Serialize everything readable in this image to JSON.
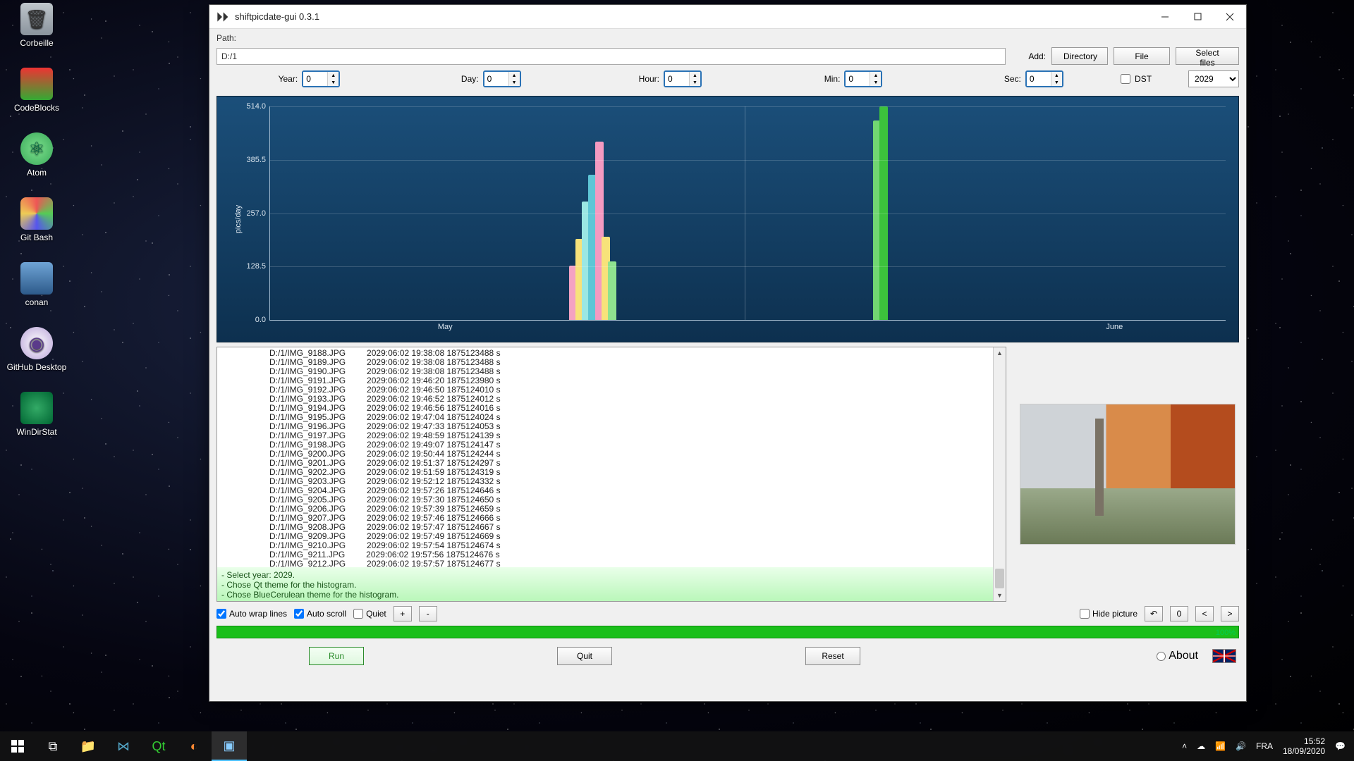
{
  "desktop": {
    "icons": [
      {
        "label": "Corbeille"
      },
      {
        "label": "CodeBlocks"
      },
      {
        "label": "Atom"
      },
      {
        "label": "Git Bash"
      },
      {
        "label": "conan"
      },
      {
        "label": "GitHub Desktop"
      },
      {
        "label": "WinDirStat"
      }
    ]
  },
  "window": {
    "title": "shiftpicdate-gui 0.3.1",
    "path_label": "Path:",
    "path_value": "D:/1",
    "add_label": "Add:",
    "btn_directory": "Directory",
    "btn_file": "File",
    "btn_select_files": "Select files",
    "dst_label": "DST",
    "year_select": "2029",
    "spinners": {
      "year": {
        "label": "Year:",
        "value": "0"
      },
      "day": {
        "label": "Day:",
        "value": "0"
      },
      "hour": {
        "label": "Hour:",
        "value": "0"
      },
      "min": {
        "label": "Min:",
        "value": "0"
      },
      "sec": {
        "label": "Sec:",
        "value": "0"
      }
    }
  },
  "chart_data": {
    "type": "bar",
    "ylabel": "pics/day",
    "ylim": [
      0,
      514
    ],
    "yticks": [
      0.0,
      128.5,
      257.0,
      385.5,
      514.0
    ],
    "xticks": [
      "May",
      "June"
    ],
    "series": [
      {
        "x_pct": 46.0,
        "value": 130,
        "color": "#f4a2c2"
      },
      {
        "x_pct": 47.0,
        "value": 195,
        "color": "#f7e27a"
      },
      {
        "x_pct": 48.0,
        "value": 285,
        "color": "#9be7e3"
      },
      {
        "x_pct": 49.0,
        "value": 350,
        "color": "#5ec6d6"
      },
      {
        "x_pct": 50.0,
        "value": 430,
        "color": "#f49ac1"
      },
      {
        "x_pct": 51.0,
        "value": 200,
        "color": "#f7e27a"
      },
      {
        "x_pct": 52.0,
        "value": 140,
        "color": "#8fe28f"
      },
      {
        "x_pct": 92.8,
        "value": 480,
        "color": "#72d672"
      },
      {
        "x_pct": 93.8,
        "value": 514,
        "color": "#3cc23c"
      }
    ]
  },
  "log": {
    "lines": [
      "D:/1/IMG_9188.JPG         2029:06:02 19:38:08 1875123488 s",
      "D:/1/IMG_9189.JPG         2029:06:02 19:38:08 1875123488 s",
      "D:/1/IMG_9190.JPG         2029:06:02 19:38:08 1875123488 s",
      "D:/1/IMG_9191.JPG         2029:06:02 19:46:20 1875123980 s",
      "D:/1/IMG_9192.JPG         2029:06:02 19:46:50 1875124010 s",
      "D:/1/IMG_9193.JPG         2029:06:02 19:46:52 1875124012 s",
      "D:/1/IMG_9194.JPG         2029:06:02 19:46:56 1875124016 s",
      "D:/1/IMG_9195.JPG         2029:06:02 19:47:04 1875124024 s",
      "D:/1/IMG_9196.JPG         2029:06:02 19:47:33 1875124053 s",
      "D:/1/IMG_9197.JPG         2029:06:02 19:48:59 1875124139 s",
      "D:/1/IMG_9198.JPG         2029:06:02 19:49:07 1875124147 s",
      "D:/1/IMG_9200.JPG         2029:06:02 19:50:44 1875124244 s",
      "D:/1/IMG_9201.JPG         2029:06:02 19:51:37 1875124297 s",
      "D:/1/IMG_9202.JPG         2029:06:02 19:51:59 1875124319 s",
      "D:/1/IMG_9203.JPG         2029:06:02 19:52:12 1875124332 s",
      "D:/1/IMG_9204.JPG         2029:06:02 19:57:26 1875124646 s",
      "D:/1/IMG_9205.JPG         2029:06:02 19:57:30 1875124650 s",
      "D:/1/IMG_9206.JPG         2029:06:02 19:57:39 1875124659 s",
      "D:/1/IMG_9207.JPG         2029:06:02 19:57:46 1875124666 s",
      "D:/1/IMG_9208.JPG         2029:06:02 19:57:47 1875124667 s",
      "D:/1/IMG_9209.JPG         2029:06:02 19:57:49 1875124669 s",
      "D:/1/IMG_9210.JPG         2029:06:02 19:57:54 1875124674 s",
      "D:/1/IMG_9211.JPG         2029:06:02 19:57:56 1875124676 s",
      "D:/1/IMG_9212.JPG         2029:06:02 19:57:57 1875124677 s"
    ],
    "status": [
      "- Select year: 2029.",
      "- Chose Qt theme for the histogram.",
      "- Chose BlueCerulean theme for the histogram."
    ]
  },
  "options": {
    "auto_wrap": "Auto wrap lines",
    "auto_scroll": "Auto scroll",
    "quiet": "Quiet",
    "plus": "+",
    "minus": "-",
    "hide_picture": "Hide picture",
    "rot_left": "↶",
    "zero": "0",
    "prev": "<",
    "next": ">"
  },
  "progress": {
    "pct_label": "100%"
  },
  "buttons": {
    "run": "Run",
    "quit": "Quit",
    "reset": "Reset",
    "about": "About"
  },
  "taskbar": {
    "lang": "FRA",
    "time": "15:52",
    "date": "18/09/2020"
  }
}
